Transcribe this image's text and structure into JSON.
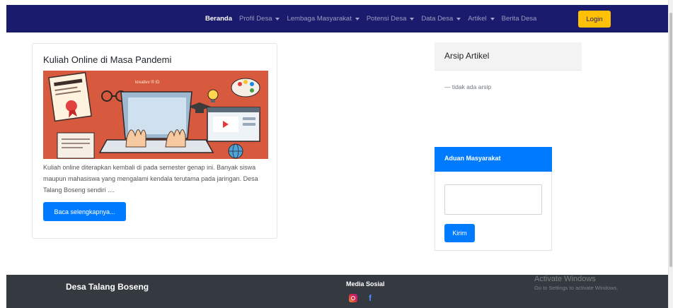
{
  "navbar": {
    "items": [
      {
        "label": "Beranda",
        "active": true,
        "dropdown": false
      },
      {
        "label": "Profil Desa",
        "active": false,
        "dropdown": true
      },
      {
        "label": "Lembaga Masyarakat",
        "active": false,
        "dropdown": true
      },
      {
        "label": "Potensi Desa",
        "active": false,
        "dropdown": true
      },
      {
        "label": "Data Desa",
        "active": false,
        "dropdown": true
      },
      {
        "label": "Artikel",
        "active": false,
        "dropdown": true
      },
      {
        "label": "Berita Desa",
        "active": false,
        "dropdown": false
      }
    ],
    "login_label": "Login",
    "colors": {
      "background": "#1b1b6e",
      "login": "#ffc107"
    }
  },
  "article": {
    "title": "Kuliah Online di Masa Pandemi",
    "image_banner": "kreativv ® ID",
    "excerpt": "Kuliah online diterapkan kembali di pada semester genap ini. Banyak siswa maupun mahasiswa yang mengalami kendala terutama pada jaringan. Desa Talang Boseng sendiri ....",
    "read_more_label": "Baca selengkapnya..."
  },
  "arsip": {
    "title": "Arsip Artikel",
    "empty_text": "— tidak ada arsip"
  },
  "aduan": {
    "title": "Aduan Masyarakat",
    "textarea_value": "",
    "submit_label": "Kirim"
  },
  "footer": {
    "brand": "Desa Talang Boseng",
    "social_title": "Media Sosial",
    "social_icons": [
      "instagram-icon",
      "facebook-icon"
    ]
  },
  "watermark": {
    "title": "Activate Windows",
    "subtitle": "Go to Settings to activate Windows."
  },
  "colors": {
    "primary": "#007bff",
    "footer": "#343a40"
  }
}
